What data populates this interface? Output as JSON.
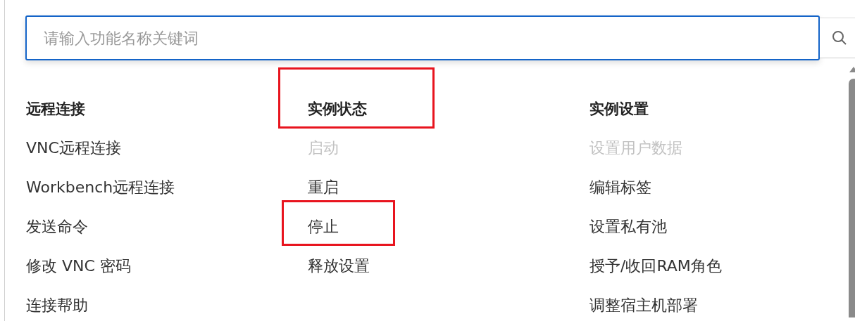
{
  "search": {
    "placeholder": "请输入功能名称关键词"
  },
  "columns": [
    {
      "title": "远程连接",
      "highlighted": false,
      "items": [
        {
          "label": "VNC远程连接",
          "disabled": false,
          "highlighted": false
        },
        {
          "label": "Workbench远程连接",
          "disabled": false,
          "highlighted": false
        },
        {
          "label": "发送命令",
          "disabled": false,
          "highlighted": false
        },
        {
          "label": "修改 VNC 密码",
          "disabled": false,
          "highlighted": false
        },
        {
          "label": "连接帮助",
          "disabled": false,
          "highlighted": false
        }
      ]
    },
    {
      "title": "实例状态",
      "highlighted": true,
      "items": [
        {
          "label": "启动",
          "disabled": true,
          "highlighted": false
        },
        {
          "label": "重启",
          "disabled": false,
          "highlighted": false
        },
        {
          "label": "停止",
          "disabled": false,
          "highlighted": true
        },
        {
          "label": "释放设置",
          "disabled": false,
          "highlighted": false
        }
      ]
    },
    {
      "title": "实例设置",
      "highlighted": false,
      "items": [
        {
          "label": "设置用户数据",
          "disabled": true,
          "highlighted": false
        },
        {
          "label": "编辑标签",
          "disabled": false,
          "highlighted": false
        },
        {
          "label": "设置私有池",
          "disabled": false,
          "highlighted": false
        },
        {
          "label": "授予/收回RAM角色",
          "disabled": false,
          "highlighted": false
        },
        {
          "label": "调整宿主机部署",
          "disabled": false,
          "highlighted": false
        }
      ]
    }
  ]
}
